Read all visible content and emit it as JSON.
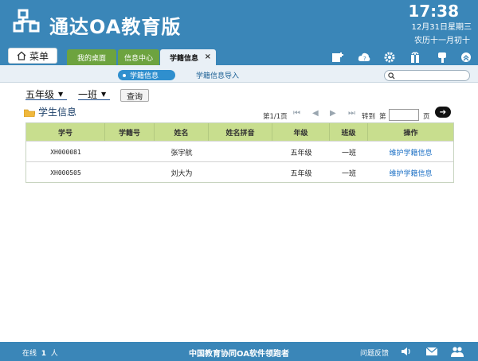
{
  "app": {
    "title": "通达OA教育版"
  },
  "clock": {
    "time": "17:38",
    "date": "12月31日星期三",
    "lunar": "农历十一月初十"
  },
  "menu": {
    "label": "菜单"
  },
  "tabs": [
    {
      "label": "我的桌面"
    },
    {
      "label": "信息中心"
    },
    {
      "label": "学籍信息",
      "close": "×"
    }
  ],
  "subtabs": [
    {
      "label": "学籍信息"
    },
    {
      "label": "学籍信息导入"
    }
  ],
  "search": {
    "placeholder": ""
  },
  "filters": {
    "grade": "五年级",
    "class": "一班",
    "query_label": "查询"
  },
  "section": {
    "title": "学生信息"
  },
  "pager": {
    "page_info": "第1/1页",
    "goto_label": "转到",
    "page_prefix": "第",
    "page_suffix": "页",
    "first": "⏮",
    "prev": "◀",
    "next": "▶",
    "last": "⏭",
    "go": "➔"
  },
  "table": {
    "headers": [
      "学号",
      "学籍号",
      "姓名",
      "姓名拼音",
      "年级",
      "班级",
      "操作"
    ],
    "rows": [
      {
        "id": "XH000081",
        "reg_no": "",
        "name": "张宇航",
        "pinyin": "",
        "grade": "五年级",
        "class": "一班",
        "action": "维护学籍信息"
      },
      {
        "id": "XH000505",
        "reg_no": "",
        "name": "刘大为",
        "pinyin": "",
        "grade": "五年级",
        "class": "一班",
        "action": "维护学籍信息"
      }
    ]
  },
  "footer": {
    "online_label": "在线",
    "online_count": "1",
    "online_unit": "人",
    "center": "中国教育协同OA软件领跑者",
    "feedback": "问题反馈"
  },
  "colors": {
    "brand": "#3a86b8",
    "tab_green": "#6da33f",
    "table_header": "#c8de8e",
    "link": "#1b6fc4"
  }
}
